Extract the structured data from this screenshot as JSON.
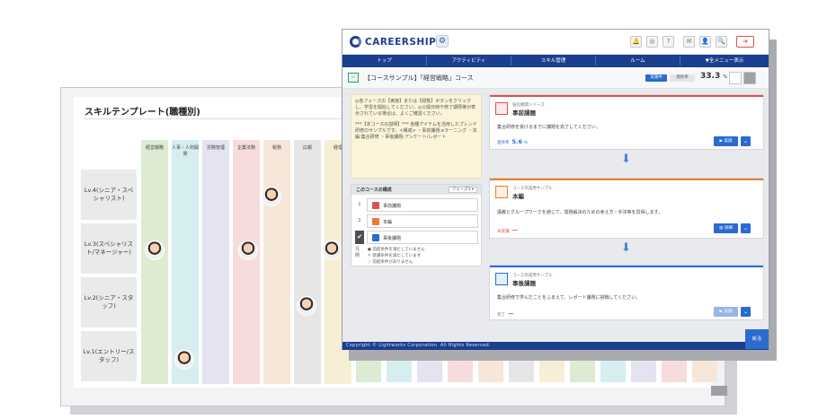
{
  "skill_template": {
    "title": "スキルテンプレート(職種別)",
    "columns": [
      "経営戦略",
      "人事・人材開発",
      "労務管理",
      "企業法務",
      "税務",
      "広報",
      "経理"
    ],
    "column_colors": [
      "#dcebd2",
      "#d6eef0",
      "#e3e3f1",
      "#f6dcdc",
      "#f7e7d8",
      "#e6e6e6",
      "#f6efd6"
    ],
    "levels": [
      "Lv.4(シニア・スペシャリスト)",
      "Lv.3(スペシャリスト/マネージャー)",
      "Lv.2(シニア・スタッフ)",
      "Lv.1(エントリー/スタッフ)"
    ]
  },
  "app": {
    "logo": "CAREERSHIP",
    "gear_icon": "gear-icon",
    "toolbar_icons": [
      "bell-icon",
      "lightbulb-icon",
      "help-icon",
      "mail-icon",
      "user-icon",
      "search-icon",
      "logout-icon"
    ],
    "toolbar_glyphs": [
      "🔔",
      "◎",
      "?",
      "✉",
      "👤",
      "🔍",
      "➜"
    ],
    "nav": [
      "トップ",
      "アクティビティ",
      "スキル管理",
      "ルーム",
      "▼全メニュー表示"
    ]
  },
  "course": {
    "title": "【コースサンプル】「経営戦略」コース",
    "status": "実施中",
    "status_sub": "進捗率",
    "progress": "33.3",
    "progress_unit": "%"
  },
  "note": {
    "paragraph1": "◎各フェーズの【実施】または【閲覧】ボタンをクリックし、学習を開始してください。◎公開日時や修了期限等が表示されている場合は、よくご確認ください。",
    "paragraph2": "***【本コースの説明】*** 各種アイテムを活用したブレンド研修のサンプルです。<構成> ・事前課題:eラーニング ・本編:集合研修 ・事後課題:アンケート/レポート"
  },
  "structure": {
    "title": "このコースの構成",
    "phase_label": "フェーズ3 ▾",
    "steps": [
      {
        "num": "1",
        "label": "事前課題",
        "color": "#d9534f"
      },
      {
        "num": "2",
        "label": "本編",
        "color": "#e87d2f"
      },
      {
        "num": "✔",
        "label": "事後課題",
        "color": "#2a6bd0"
      }
    ],
    "legend_tag": "凡例",
    "legend": [
      "●  前提条件を満たしていません",
      "✎  受講条件を満たしています",
      "◌  前提条件がありません"
    ]
  },
  "cards": [
    {
      "subtitle": "強化機関シリーズ",
      "name": "事前課題",
      "desc": "集合研修を受けるまでに課題を完了してください。",
      "metric_label": "進捗率",
      "metric_value": "5.6",
      "metric_unit": "%",
      "button": "▶ 実施",
      "color": "#d9534f"
    },
    {
      "subtitle": "コース作成用サンプル",
      "name": "本編",
      "desc": "講義とグループワークを通じて、問題解決のための考え方・手法等を習得します。",
      "metric_label": "未受講",
      "metric_value": "ー",
      "metric_unit": "",
      "button": "▤ 詳細",
      "color": "#e87d2f"
    },
    {
      "subtitle": "コース作成用サンプル",
      "name": "事後課題",
      "desc": "集合研修で学んだことをふまえて、レポート課題に挑戦してください。",
      "metric_label": "完了",
      "metric_value": "ー",
      "metric_unit": "",
      "button": "▶ 実施",
      "color": "#2a6bd0"
    }
  ],
  "footer": {
    "copyright": "Copyright © Lightworks Corporation. All Rights Reserved.",
    "back_button": "戻る"
  }
}
